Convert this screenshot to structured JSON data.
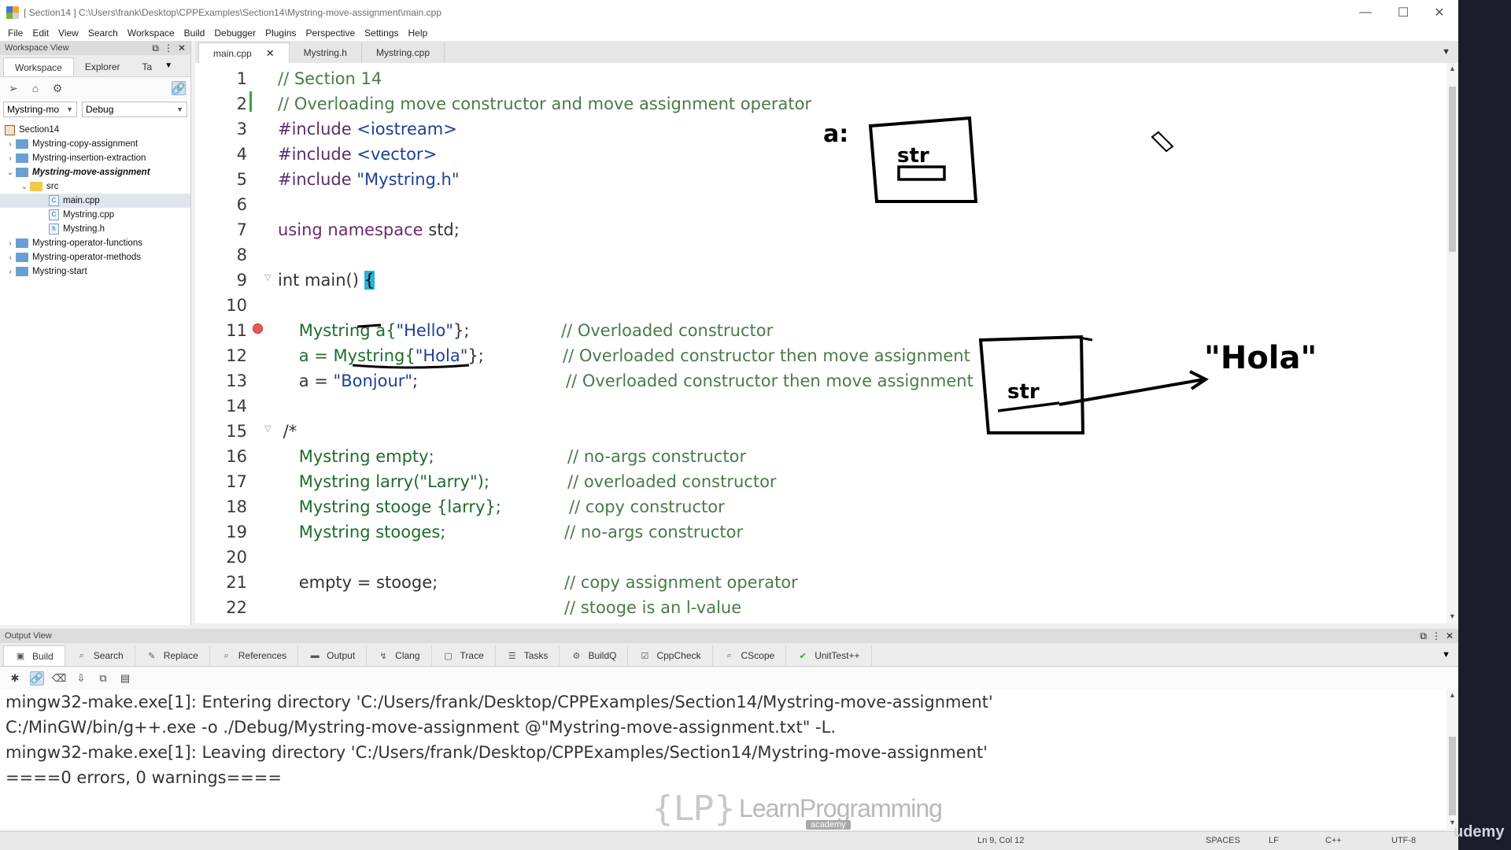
{
  "window": {
    "title": "[ Section14 ] C:\\Users\\frank\\Desktop\\CPPExamples\\Section14\\Mystring-move-assignment\\main.cpp",
    "minimize": "—",
    "maximize": "☐",
    "close": "✕"
  },
  "menu": [
    "File",
    "Edit",
    "View",
    "Search",
    "Workspace",
    "Build",
    "Debugger",
    "Plugins",
    "Perspective",
    "Settings",
    "Help"
  ],
  "workspace": {
    "header": "Workspace View",
    "tabs": [
      "Workspace",
      "Explorer",
      "Ta"
    ],
    "project_select": "Mystring-mo",
    "config_select": "Debug",
    "tree": {
      "root": "Section14",
      "items": [
        "Mystring-copy-assignment",
        "Mystring-insertion-extraction",
        "Mystring-move-assignment",
        "src",
        "main.cpp",
        "Mystring.cpp",
        "Mystring.h",
        "Mystring-operator-functions",
        "Mystring-operator-methods",
        "Mystring-start"
      ]
    }
  },
  "editor": {
    "tabs": [
      "main.cpp",
      "Mystring.h",
      "Mystring.cpp"
    ],
    "line_numbers": [
      "1",
      "2",
      "3",
      "4",
      "5",
      "6",
      "7",
      "8",
      "9",
      "10",
      "11",
      "12",
      "13",
      "14",
      "15",
      "16",
      "17",
      "18",
      "19",
      "20",
      "21",
      "22"
    ],
    "code": {
      "l1": "// Section 14",
      "l2": "// Overloading move constructor and move assignment operator",
      "l3a": "#include ",
      "l3b": "<iostream>",
      "l4a": "#include ",
      "l4b": "<vector>",
      "l5a": "#include ",
      "l5b": "\"Mystring.h\"",
      "l7a": "using namespace ",
      "l7b": "std;",
      "l9a": "int main() ",
      "l9b": "{",
      "l11a": "    Mystring a{",
      "l11b": "\"Hello\"",
      "l11c": "};",
      "l11d": "// Overloaded constructor",
      "l12a": "    a = Mystring{",
      "l12b": "\"Hola\"",
      "l12c": "};",
      "l12d": "// Overloaded constructor then move assignment",
      "l13a": "    a = ",
      "l13b": "\"Bonjour\"",
      "l13c": ";",
      "l13d": "// Overloaded constructor then move assignment",
      "l15": " /*",
      "l16a": "    Mystring empty;",
      "l16b": "// no-args constructor",
      "l17a": "    Mystring larry(\"Larry\");",
      "l17b": "// overloaded constructor",
      "l18a": "    Mystring stooge {larry};",
      "l18b": "// copy constructor",
      "l19a": "    Mystring stooges;",
      "l19b": "// no-args constructor",
      "l21a": "    empty = stooge;",
      "l21b": "// copy assignment operator",
      "l22b": "// stooge is an l-value"
    }
  },
  "output": {
    "header": "Output View",
    "tabs": [
      "Build",
      "Search",
      "Replace",
      "References",
      "Output",
      "Clang",
      "Trace",
      "Tasks",
      "BuildQ",
      "CppCheck",
      "CScope",
      "UnitTest++"
    ],
    "lines": [
      "mingw32-make.exe[1]: Entering directory 'C:/Users/frank/Desktop/CPPExamples/Section14/Mystring-move-assignment'",
      "C:/MinGW/bin/g++.exe -o ./Debug/Mystring-move-assignment @\"Mystring-move-assignment.txt\" -L.",
      "mingw32-make.exe[1]: Leaving directory 'C:/Users/frank/Desktop/CPPExamples/Section14/Mystring-move-assignment'",
      "====0 errors, 0 warnings===="
    ]
  },
  "statusbar": {
    "position": "Ln 9, Col 12",
    "indent": "SPACES",
    "eol": "LF",
    "language": "C++",
    "encoding": "UTF-8"
  },
  "annotations": {
    "label_a": "a:",
    "str1": "str",
    "str2": "str",
    "hola": "\"Hola\""
  },
  "watermark": {
    "braces": "{LP}",
    "brand": "LearnProgramming",
    "sub": "academy",
    "udemy": "udemy"
  },
  "colors": {
    "breakpoint": "#e85a4f",
    "brace_highlight": "#27b3d6",
    "comment": "#4a7a4a",
    "string": "#1d3f97",
    "keyword": "#6b2a6b"
  }
}
